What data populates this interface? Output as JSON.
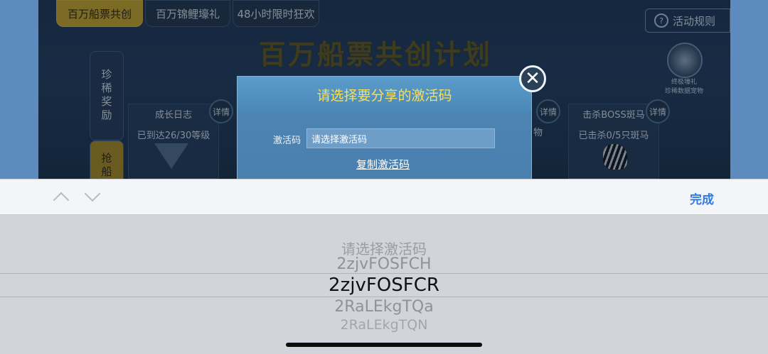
{
  "game": {
    "tabs": [
      "百万船票共创",
      "百万锦鲤壕礼",
      "48小时限时狂欢"
    ],
    "rules_label": "活动规则",
    "banner_title": "百万船票共创计划",
    "vertical_tabs": [
      "珍稀奖励",
      "抢船"
    ],
    "cards": [
      {
        "title": "成长日志",
        "status": "已到达26/30等级",
        "detail": "详情"
      },
      {
        "title": "击杀BOSS斑马",
        "status": "已击杀0/5只斑马",
        "detail": "详情"
      }
    ],
    "partial_card_text": "物",
    "middle_detail": "详情",
    "pet_caption": "终极壕礼\n珍稀数据宠物"
  },
  "modal": {
    "title": "请选择要分享的激活码",
    "field_label": "激活码",
    "field_value": "请选择激活码",
    "copy_link": "复制激活码",
    "close_icon": "close-icon"
  },
  "toolbar": {
    "prev_icon": "chevron-up-icon",
    "next_icon": "chevron-down-icon",
    "done_label": "完成"
  },
  "picker": {
    "options": [
      "请选择激活码",
      "2zjvFOSFCH",
      "2zjvFOSFCR",
      "2RaLEkgTQa",
      "2RaLEkgTQN"
    ],
    "selected_index": 2
  }
}
